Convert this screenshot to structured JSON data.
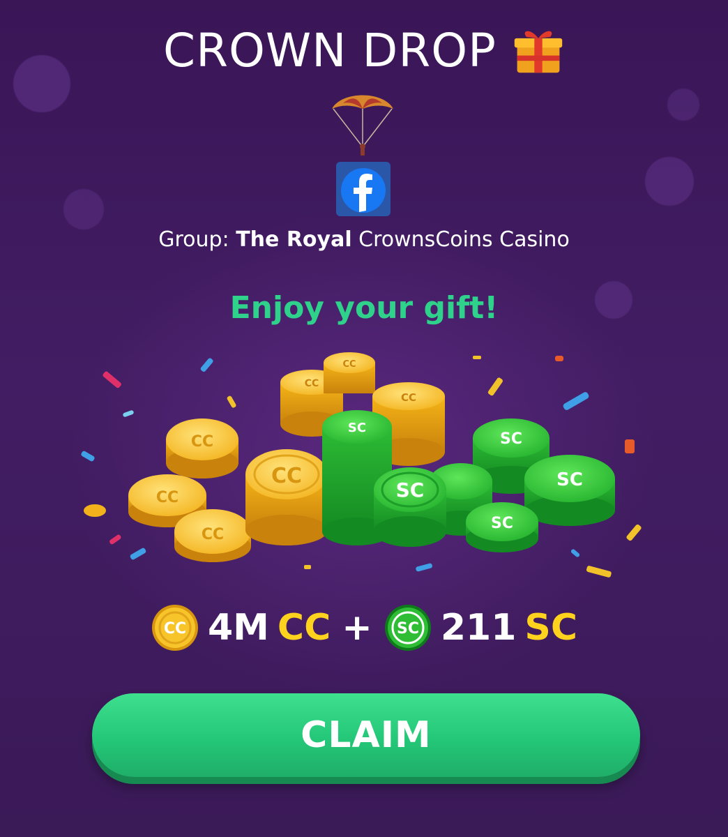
{
  "header": {
    "title": "CROWN DROP",
    "title_icon": "gift-icon"
  },
  "decor": {
    "parachute_icon": "parachute-icon",
    "social_icon": "facebook-icon"
  },
  "group": {
    "prefix": "Group:",
    "name_bold": "The Royal",
    "name_rest": "CrownsCoins Casino"
  },
  "message": "Enjoy your gift!",
  "coins": {
    "cc_label": "CC",
    "sc_label": "SC"
  },
  "reward": {
    "cc_amount": "4M",
    "cc_unit": "CC",
    "plus": "+",
    "sc_amount": "211",
    "sc_unit": "SC"
  },
  "claim_button": {
    "label": "CLAIM"
  },
  "colors": {
    "background": "#3d1a5c",
    "accent_green": "#2fd28a",
    "gold": "#ffd21e",
    "button_green": "#24c778"
  }
}
